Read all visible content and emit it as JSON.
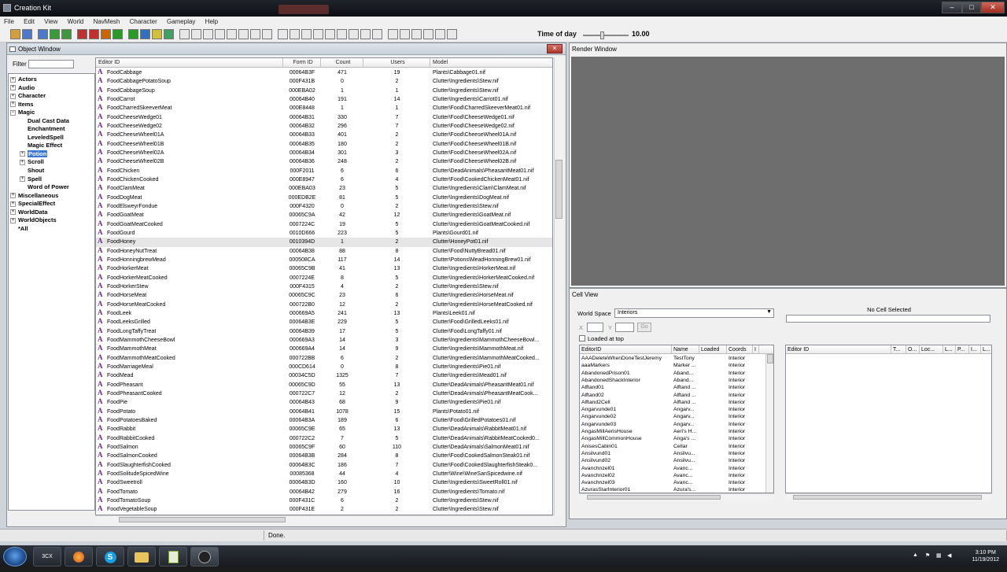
{
  "window": {
    "title": "Creation Kit",
    "min": "–",
    "max": "□",
    "close": "✕"
  },
  "menu": [
    "File",
    "Edit",
    "View",
    "World",
    "NavMesh",
    "Character",
    "Gameplay",
    "Help"
  ],
  "time_of_day": {
    "label": "Time of day",
    "value": "10.00",
    "level": 0.41
  },
  "object_window": {
    "title": "Object Window",
    "close": "✕",
    "filter_label": "Filter",
    "filter_value": ""
  },
  "tree": [
    {
      "label": "Actors",
      "level": 0,
      "exp": "+"
    },
    {
      "label": "Audio",
      "level": 0,
      "exp": "+"
    },
    {
      "label": "Character",
      "level": 0,
      "exp": "+"
    },
    {
      "label": "Items",
      "level": 0,
      "exp": "+"
    },
    {
      "label": "Magic",
      "level": 0,
      "exp": "−"
    },
    {
      "label": "Dual Cast Data",
      "level": 1,
      "exp": ""
    },
    {
      "label": "Enchantment",
      "level": 1,
      "exp": ""
    },
    {
      "label": "LeveledSpell",
      "level": 1,
      "exp": ""
    },
    {
      "label": "Magic Effect",
      "level": 1,
      "exp": ""
    },
    {
      "label": "Potion",
      "level": 1,
      "exp": "+",
      "selected": true
    },
    {
      "label": "Scroll",
      "level": 1,
      "exp": "+"
    },
    {
      "label": "Shout",
      "level": 1,
      "exp": ""
    },
    {
      "label": "Spell",
      "level": 1,
      "exp": "+"
    },
    {
      "label": "Word of Power",
      "level": 1,
      "exp": ""
    },
    {
      "label": "Miscellaneous",
      "level": 0,
      "exp": "+"
    },
    {
      "label": "SpecialEffect",
      "level": 0,
      "exp": "+"
    },
    {
      "label": "WorldData",
      "level": 0,
      "exp": "+"
    },
    {
      "label": "WorldObjects",
      "level": 0,
      "exp": "+"
    },
    {
      "label": "*All",
      "level": 0,
      "exp": ""
    }
  ],
  "grid": {
    "columns": [
      "Editor ID",
      "Form ID",
      "Count",
      "Users",
      "Model"
    ],
    "rows": [
      [
        "FoodCabbage",
        "00064B3F",
        "471",
        "19",
        "Plants\\Cabbage01.nif"
      ],
      [
        "FoodCabbagePotatoSoup",
        "000F431B",
        "0",
        "2",
        "Clutter\\Ingredients\\Stew.nif"
      ],
      [
        "FoodCabbageSoup",
        "000EBA02",
        "1",
        "1",
        "Clutter\\Ingredients\\Stew.nif"
      ],
      [
        "FoodCarrot",
        "00064B40",
        "191",
        "14",
        "Clutter\\Ingredients\\Carrot01.nif"
      ],
      [
        "FoodCharredSkeeverMeat",
        "000E8448",
        "1",
        "1",
        "Clutter\\Food\\CharredSkeeverMeat01.nif"
      ],
      [
        "FoodCheeseWedge01",
        "00064B31",
        "330",
        "7",
        "Clutter\\Food\\CheeseWedge01.nif"
      ],
      [
        "FoodCheeseWedge02",
        "00064B32",
        "296",
        "7",
        "Clutter\\Food\\CheeseWedge02.nif"
      ],
      [
        "FoodCheeseWheel01A",
        "00064B33",
        "401",
        "2",
        "Clutter\\Food\\CheeseWheel01A.nif"
      ],
      [
        "FoodCheeseWheel01B",
        "00064B35",
        "180",
        "2",
        "Clutter\\Food\\CheeseWheel01B.nif"
      ],
      [
        "FoodCheeseWheel02A",
        "00064B34",
        "301",
        "3",
        "Clutter\\Food\\CheeseWheel02A.nif"
      ],
      [
        "FoodCheeseWheel02B",
        "00064B36",
        "248",
        "2",
        "Clutter\\Food\\CheeseWheel02B.nif"
      ],
      [
        "FoodChicken",
        "000F2011",
        "6",
        "6",
        "Clutter\\DeadAnimals\\PheasantMeat01.nif"
      ],
      [
        "FoodChickenCooked",
        "000E8947",
        "6",
        "4",
        "Clutter\\Food\\CookedChickenMeat01.nif"
      ],
      [
        "FoodClamMeat",
        "000EBA03",
        "23",
        "5",
        "Clutter\\Ingredients\\Clam\\ClamMeat.nif"
      ],
      [
        "FoodDogMeat",
        "000EDB2E",
        "81",
        "5",
        "Clutter\\Ingredients\\DogMeat.nif"
      ],
      [
        "FoodElsweyrFondue",
        "000F4320",
        "0",
        "2",
        "Clutter\\Ingredients\\Stew.nif"
      ],
      [
        "FoodGoatMeat",
        "00065C9A",
        "42",
        "12",
        "Clutter\\Ingredients\\GoatMeat.nif"
      ],
      [
        "FoodGoatMeatCooked",
        "0007224C",
        "19",
        "5",
        "Clutter\\Ingredients\\GoatMeatCooked.nif"
      ],
      [
        "FoodGourd",
        "0010D666",
        "223",
        "5",
        "Plants\\Gourd01.nif"
      ],
      [
        "FoodHoney",
        "0010394D",
        "1",
        "2",
        "Clutter\\HoneyPot01.nif"
      ],
      [
        "FoodHoneyNutTreat",
        "00064B38",
        "88",
        "8",
        "Clutter\\Food\\NuttyBread01.nif"
      ],
      [
        "FoodHonningbrewMead",
        "000508CA",
        "117",
        "14",
        "Clutter\\Potions\\MeadHonningBrew01.nif"
      ],
      [
        "FoodHorkerMeat",
        "00065C9B",
        "41",
        "13",
        "Clutter\\Ingredients\\HorkerMeat.nif"
      ],
      [
        "FoodHorkerMeatCooked",
        "0007224E",
        "8",
        "5",
        "Clutter\\Ingredients\\HorkerMeatCooked.nif"
      ],
      [
        "FoodHorkerStew",
        "000F4315",
        "4",
        "2",
        "Clutter\\Ingredients\\Stew.nif"
      ],
      [
        "FoodHorseMeat",
        "00065C9C",
        "23",
        "6",
        "Clutter\\Ingredients\\HorseMeat.nif"
      ],
      [
        "FoodHorseMeatCooked",
        "000722B0",
        "12",
        "2",
        "Clutter\\Ingredients\\HorseMeatCooked.nif"
      ],
      [
        "FoodLeek",
        "000669A5",
        "241",
        "13",
        "Plants\\Leek01.nif"
      ],
      [
        "FoodLeeksGrilled",
        "00064B3E",
        "229",
        "5",
        "Clutter\\Food\\GrilledLeeks01.nif"
      ],
      [
        "FoodLongTaffyTreat",
        "00064B39",
        "17",
        "5",
        "Clutter\\Food\\LongTaffy01.nif"
      ],
      [
        "FoodMammothCheeseBowl",
        "000669A3",
        "14",
        "3",
        "Clutter\\Ingredients\\MammothCheeseBowl..."
      ],
      [
        "FoodMammothMeat",
        "000669A4",
        "14",
        "9",
        "Clutter\\Ingredients\\MammothMeat.nif"
      ],
      [
        "FoodMammothMeatCooked",
        "000722BB",
        "6",
        "2",
        "Clutter\\Ingredients\\MammothMeatCooked..."
      ],
      [
        "FoodMarriageMeal",
        "000CD614",
        "0",
        "8",
        "Clutter\\Ingredients\\Pie01.nif"
      ],
      [
        "FoodMead",
        "00034C5D",
        "1325",
        "7",
        "Clutter\\Ingredients\\Mead01.nif"
      ],
      [
        "FoodPheasant",
        "00065C9D",
        "55",
        "13",
        "Clutter\\DeadAnimals\\PheasantMeat01.nif"
      ],
      [
        "FoodPheasantCooked",
        "000722C7",
        "12",
        "2",
        "Clutter\\DeadAnimals\\PheasantMeatCook..."
      ],
      [
        "FoodPie",
        "00064B43",
        "68",
        "9",
        "Clutter\\Ingredients\\Pie01.nif"
      ],
      [
        "FoodPotato",
        "00064B41",
        "1078",
        "15",
        "Plants\\Potato01.nif"
      ],
      [
        "FoodPotatoesBaked",
        "00064B3A",
        "189",
        "6",
        "Clutter\\Food\\GrilledPotatoes01.nif"
      ],
      [
        "FoodRabbit",
        "00065C9E",
        "65",
        "13",
        "Clutter\\DeadAnimals\\RabbitMeat01.nif"
      ],
      [
        "FoodRabbitCooked",
        "000722C2",
        "7",
        "5",
        "Clutter\\DeadAnimals\\RabbitMeatCooked0..."
      ],
      [
        "FoodSalmon",
        "00065C9F",
        "60",
        "110",
        "Clutter\\DeadAnimals\\SalmonMeat01.nif"
      ],
      [
        "FoodSalmonCooked",
        "00064B3B",
        "284",
        "8",
        "Clutter\\Food\\CookedSalmonSteak01.nif"
      ],
      [
        "FoodSlaughterfishCooked",
        "00064B3C",
        "186",
        "7",
        "Clutter\\Food\\CookedSlaughterfishSteak0..."
      ],
      [
        "FoodSolitudeSpicedWine",
        "00085368",
        "44",
        "4",
        "Clutter\\Wine\\WineSanSpicedwine.nif"
      ],
      [
        "FoodSweetroll",
        "00064B3D",
        "160",
        "10",
        "Clutter\\Ingredients\\SweetRoll01.nif"
      ],
      [
        "FoodTomato",
        "00064B42",
        "279",
        "16",
        "Clutter\\Ingredients\\Tomato.nif"
      ],
      [
        "FoodTomatoSoup",
        "000F431C",
        "6",
        "2",
        "Clutter\\Ingredients\\Stew.nif"
      ],
      [
        "FoodVegetableSoup",
        "000F431E",
        "2",
        "2",
        "Clutter\\Ingredients\\Stew.nif"
      ]
    ]
  },
  "render_window": {
    "title": "Render Window"
  },
  "cell_view": {
    "title": "Cell View",
    "world_space_label": "World Space",
    "world_space_value": "Interiors",
    "x_label": "X",
    "y_label": "Y",
    "go_label": "Go",
    "loaded_at_top": "Loaded at top",
    "no_cell": "No Cell Selected",
    "left_columns": [
      "EditorID",
      "Name",
      "Loaded",
      "Coords",
      "I"
    ],
    "left_rows": [
      [
        "AAADeleteWhenDoneTestJeremy",
        "TestTony",
        "",
        "Interior"
      ],
      [
        "aaaMarkers",
        "Marker ...",
        "",
        "Interior"
      ],
      [
        "AbandonedPrison01",
        "Aband...",
        "",
        "Interior"
      ],
      [
        "AbandonedShackInterior",
        "Aband...",
        "",
        "Interior"
      ],
      [
        "Alftand01",
        "Alftand ...",
        "",
        "Interior"
      ],
      [
        "Alftand02",
        "Alftand ...",
        "",
        "Interior"
      ],
      [
        "Alftand2Cell",
        "Alftand ...",
        "",
        "Interior"
      ],
      [
        "Angarvunde01",
        "Angarv...",
        "",
        "Interior"
      ],
      [
        "Angarvunde02",
        "Angarv...",
        "",
        "Interior"
      ],
      [
        "Angarvunde03",
        "Angarv...",
        "",
        "Interior"
      ],
      [
        "AngasMillAerisHouse",
        "Aeri's H...",
        "",
        "Interior"
      ],
      [
        "AngasMillCommonHouse",
        "Anga's ...",
        "",
        "Interior"
      ],
      [
        "AnisesCabin01",
        "Cellar",
        "",
        "Interior"
      ],
      [
        "Ansilvund01",
        "Ansilvu...",
        "",
        "Interior"
      ],
      [
        "Ansilvund02",
        "Ansilvu...",
        "",
        "Interior"
      ],
      [
        "Avanchnzel01",
        "Avanc...",
        "",
        "Interior"
      ],
      [
        "Avanchnzel02",
        "Avanc...",
        "",
        "Interior"
      ],
      [
        "Avanchnzel03",
        "Avanc...",
        "",
        "Interior"
      ],
      [
        "AzurasStarInterior01",
        "Azura's...",
        "",
        "Interior"
      ]
    ],
    "right_columns": [
      "Editor ID",
      "T...",
      "O...",
      "Loc...",
      "L...",
      "P...",
      "I...",
      "L..."
    ]
  },
  "status": {
    "text": "Done."
  },
  "taskbar": {
    "apps": [
      "3CX",
      "firefox",
      "skype",
      "explorer",
      "notepad",
      "creation-kit"
    ],
    "time": "3:10 PM",
    "date": "11/19/2012"
  }
}
